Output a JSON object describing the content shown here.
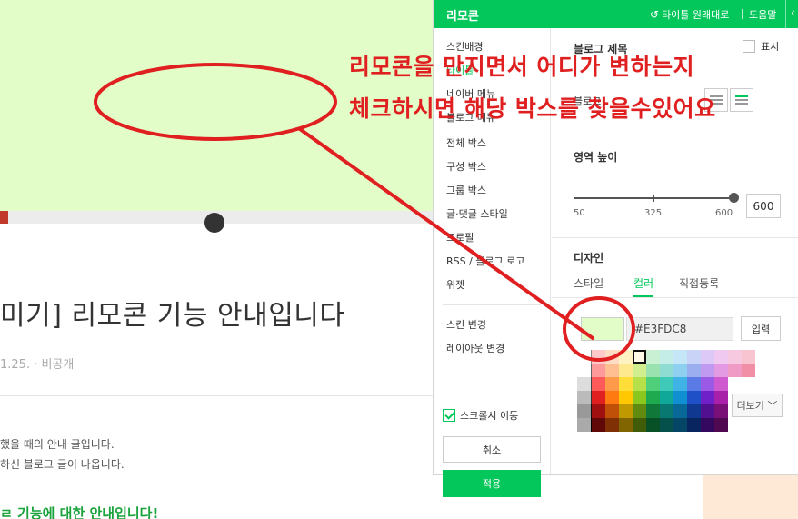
{
  "blog": {
    "title": "미기] 리모콘 기능 안내입니다",
    "meta": "1.25. · 비공개",
    "line1": "했을 때의 안내 글입니다.",
    "line2": "하신 블로그 글이 나옵니다.",
    "heading": "ㄹ 기능에 대한 안내입니다!"
  },
  "remocon": {
    "title": "리모콘",
    "reset_label": "타이틀 원래대로",
    "help_label": "도움말",
    "menu": [
      {
        "label": "스킨배경"
      },
      {
        "label": "타이틀"
      },
      {
        "label": "네이버 메뉴"
      },
      {
        "label": "블로그 메뉴"
      },
      {
        "label": "전체 박스"
      },
      {
        "label": "구성 박스"
      },
      {
        "label": "그룹 박스"
      },
      {
        "label": "글·댓글 스타일"
      },
      {
        "label": "프로필"
      },
      {
        "label": "RSS / 블로그 로고"
      },
      {
        "label": "위젯"
      }
    ],
    "skin_change": "스킨 변경",
    "layout_change": "레이아웃 변경",
    "scroll_move": "스크롤시 이동",
    "cancel": "취소",
    "apply": "적용",
    "blog_title_section": "블로그 제목",
    "show_label": "표시",
    "title_font_partial": "블로그",
    "area_height": "영역 높이",
    "slider_min": "50",
    "slider_mid": "325",
    "slider_max": "600",
    "height_value": "600",
    "design": "디자인",
    "tabs": [
      "스타일",
      "컬러",
      "직접등록"
    ],
    "color_hex": "#E3FDC8",
    "enter_label": "입력",
    "more_label": "더보기"
  },
  "colors": {
    "accent": "#03c75a",
    "selected_color": "#E3FDC8",
    "annotation": "#e02020"
  },
  "annotation": {
    "line1": "리모콘을 만지면서 어디가 변하는지",
    "line2": "체크하시면 해당 박스를 찾을수있어요"
  }
}
